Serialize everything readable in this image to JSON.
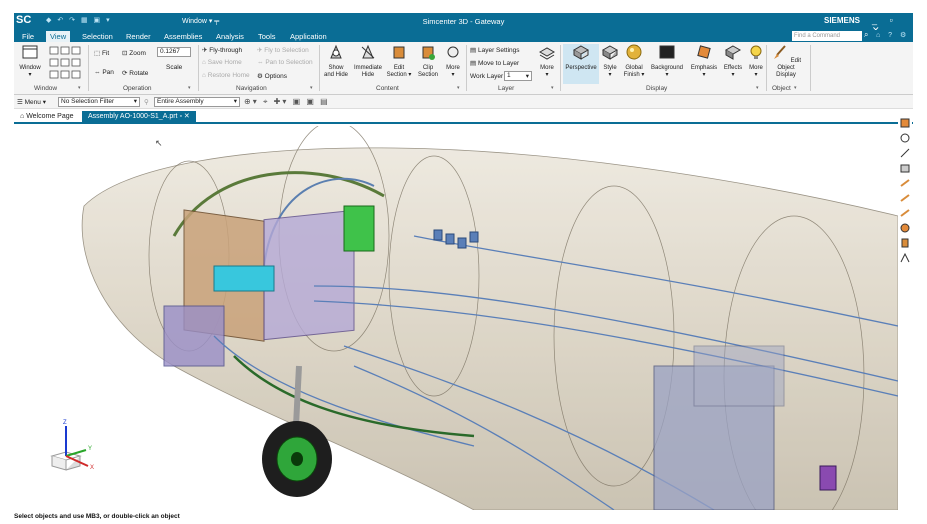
{
  "titlebar": {
    "logo": "SC",
    "window_menu": "Window ▾ ╤",
    "title": "Simcenter 3D - Gateway",
    "brand": "SIEMENS",
    "controls": "_ ▫ ✕"
  },
  "menu": {
    "tabs": [
      "File",
      "View",
      "Selection",
      "Render",
      "Assemblies",
      "Analysis",
      "Tools",
      "Application"
    ],
    "active": "View",
    "find_placeholder": "Find a Command"
  },
  "ribbon": {
    "window": {
      "label": "Window",
      "window_btn": "Window"
    },
    "operation": {
      "label": "Operation",
      "fit": "Fit",
      "zoom": "Zoom",
      "zoom_value": "0.1267",
      "pan": "Pan",
      "rotate": "Rotate",
      "scale": "Scale"
    },
    "navigation": {
      "label": "Navigation",
      "fly_through": "Fly-through",
      "fly_to_selection": "Fly to Selection",
      "save_home": "Save Home",
      "pan_to_selection": "Pan to Selection",
      "restore_home": "Restore Home",
      "options": "Options"
    },
    "content": {
      "label": "Content",
      "show_hide": [
        "Show",
        "and Hide"
      ],
      "immediate_hide": [
        "Immediate",
        "Hide"
      ],
      "edit_section": [
        "Edit",
        "Section ▾"
      ],
      "clip_section": [
        "Clip",
        "Section"
      ],
      "more": "More"
    },
    "layer": {
      "label": "Layer",
      "layer_settings": "Layer Settings",
      "move_to_layer": "Move to Layer",
      "work_layer": "Work Layer",
      "work_layer_value": "1",
      "more": "More"
    },
    "display": {
      "label": "Display",
      "perspective": "Perspective",
      "style": "Style",
      "global_finish": [
        "Global",
        "Finish ▾"
      ],
      "background": "Background",
      "emphasis": "Emphasis",
      "effects": "Effects",
      "more": "More"
    },
    "object": {
      "label": "Object",
      "edit_object_display": [
        "Edit Object",
        "Display"
      ]
    }
  },
  "toolbar2": {
    "menu": "Menu ▾",
    "selection_filter": "No Selection Filter",
    "scope": "Entire Assembly"
  },
  "doctabs": {
    "welcome": "Welcome Page",
    "assembly": "Assembly AO-1000-S1_A.prt"
  },
  "triad": {
    "z": "Z",
    "y": "Y",
    "x": "X"
  },
  "status": "Select objects and use MB3, or double-click an object",
  "colors": {
    "accent": "#0a6d95",
    "fuselage": "#d9d2c3",
    "wire": "#5a7fb8",
    "green": "#3aa63a"
  }
}
